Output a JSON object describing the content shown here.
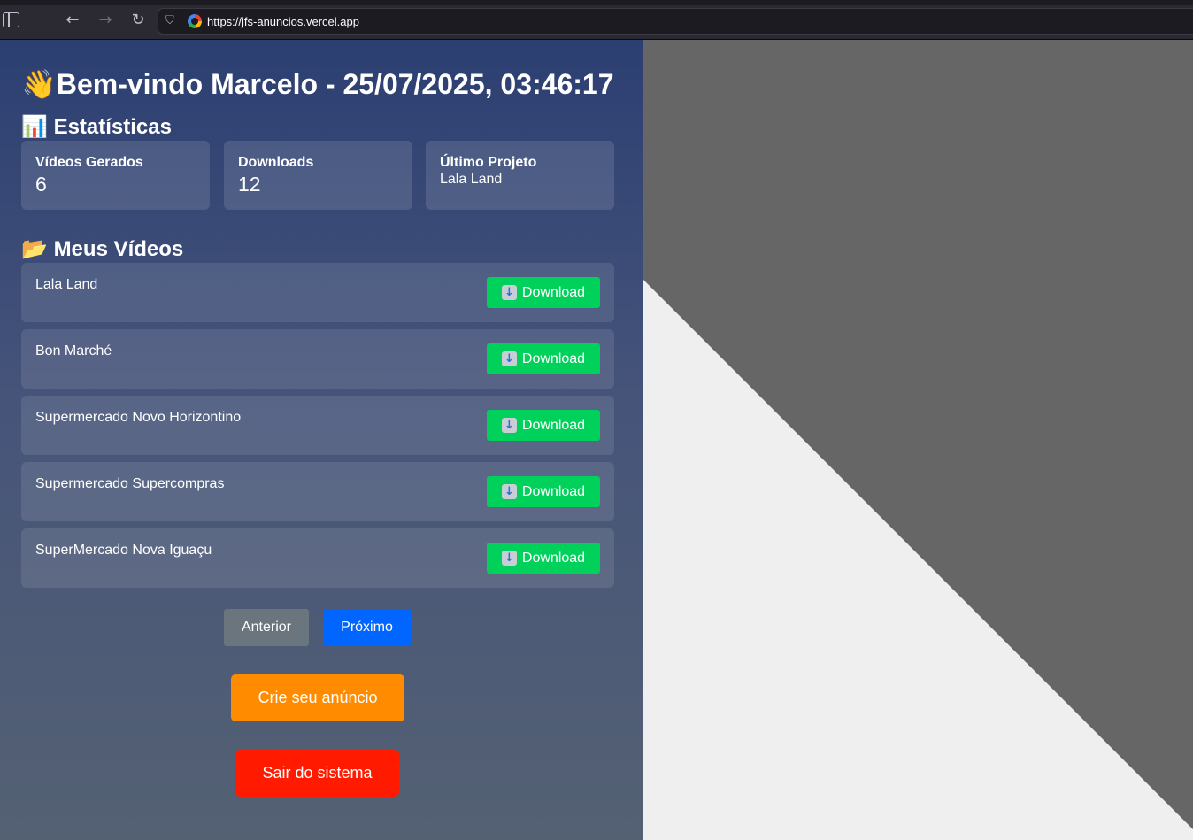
{
  "browser": {
    "url": "https://jfs-anuncios.vercel.app",
    "icons": [
      "sidebar-toggle-icon",
      "back-arrow-icon",
      "forward-arrow-icon",
      "reload-icon",
      "tracking-shield-icon",
      "site-favicon"
    ]
  },
  "header": {
    "greeting_emoji": "👋",
    "greeting": "Bem-vindo Marcelo - 25/07/2025, 03:46:17"
  },
  "stats": {
    "title_emoji": "📊",
    "title": "Estatísticas",
    "cards": [
      {
        "label": "Vídeos Gerados",
        "value": "6"
      },
      {
        "label": "Downloads",
        "value": "12"
      },
      {
        "label": "Último Projeto",
        "value": "Lala Land"
      }
    ]
  },
  "videos": {
    "title_emoji": "📂",
    "title": "Meus Vídeos",
    "download_label": "Download",
    "items": [
      {
        "title": "Lala Land"
      },
      {
        "title": "Bon Marché"
      },
      {
        "title": "Supermercado Novo Horizontino"
      },
      {
        "title": "Supermercado Supercompras"
      },
      {
        "title": "SuperMercado Nova Iguaçu"
      }
    ]
  },
  "pagination": {
    "prev_label": "Anterior",
    "next_label": "Próximo"
  },
  "actions": {
    "create_label": "Crie seu anúncio",
    "logout_label": "Sair do sistema"
  },
  "colors": {
    "download": "#00d15a",
    "next": "#0066ff",
    "prev": "#6b757d",
    "create": "#ff8c00",
    "logout": "#ff1a00"
  }
}
